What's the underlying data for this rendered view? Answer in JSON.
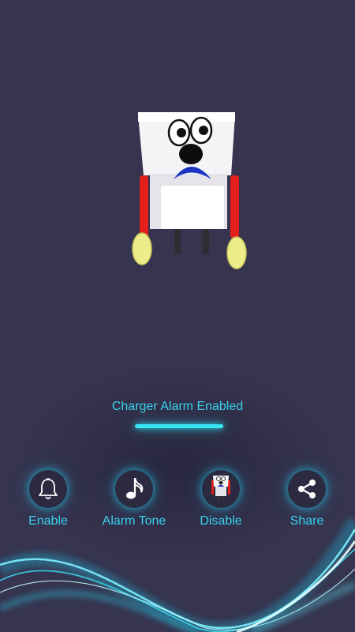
{
  "status": {
    "text": "Charger Alarm Enabled"
  },
  "actions": [
    {
      "label": "Enable",
      "icon": "bell-icon"
    },
    {
      "label": "Alarm Tone",
      "icon": "music-note-icon"
    },
    {
      "label": "Disable",
      "icon": "charger-character-icon"
    },
    {
      "label": "Share",
      "icon": "share-icon"
    }
  ],
  "colors": {
    "background": "#36344f",
    "accent": "#39d3ee"
  }
}
